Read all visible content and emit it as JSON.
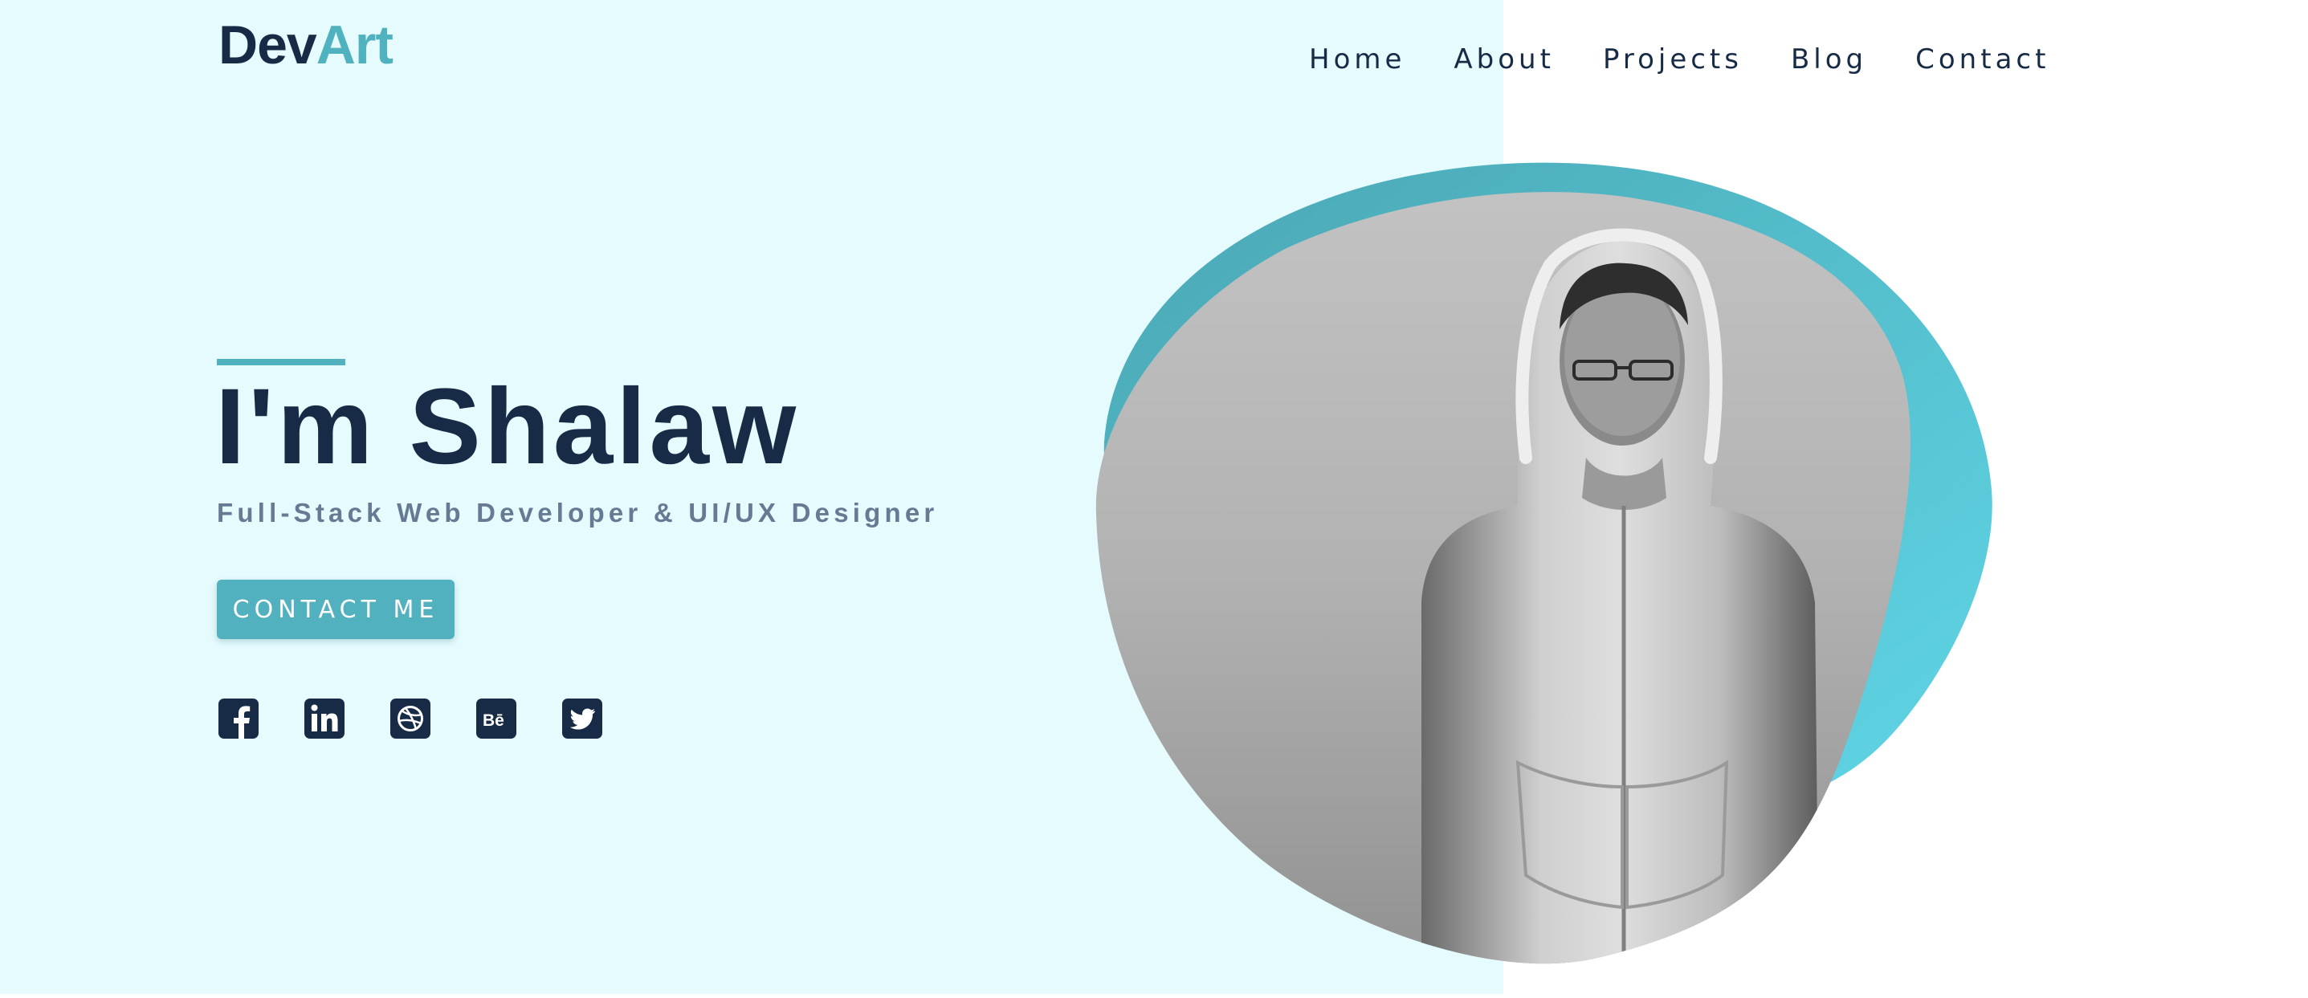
{
  "logo": {
    "text_primary": "Dev",
    "text_accent": "Art"
  },
  "nav": {
    "items": [
      {
        "label": "Home"
      },
      {
        "label": "About"
      },
      {
        "label": "Projects"
      },
      {
        "label": "Blog"
      },
      {
        "label": "Contact"
      }
    ]
  },
  "hero": {
    "headline": "I'm Shalaw",
    "subtitle": "Full-Stack Web Developer & UI/UX Designer",
    "cta_label": "CONTACT ME",
    "social": [
      {
        "icon": "facebook-icon"
      },
      {
        "icon": "linkedin-icon"
      },
      {
        "icon": "dribbble-icon"
      },
      {
        "icon": "behance-icon"
      },
      {
        "icon": "twitter-icon"
      }
    ],
    "portrait": {
      "icon": "portrait-photo"
    }
  },
  "colors": {
    "navy": "#172b46",
    "accent": "#4fb2be",
    "light_bg": "#e5fbfd",
    "subtitle": "#667b93"
  }
}
